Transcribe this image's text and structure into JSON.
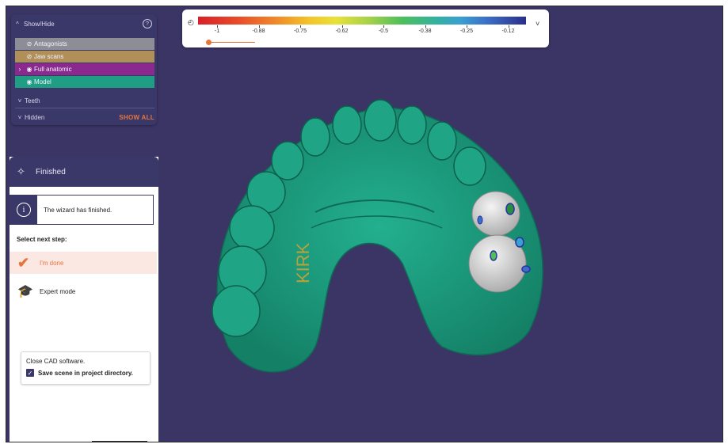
{
  "show_hide": {
    "title": "Show/Hide",
    "help_icon": "question-circle-icon",
    "layers": [
      {
        "label": "Antagonists",
        "color": "#8d8d96"
      },
      {
        "label": "Jaw scans",
        "color": "#b08f58"
      },
      {
        "label": "Full anatomic",
        "color": "#8a2a8e"
      },
      {
        "label": "Model",
        "color": "#1f9e83"
      }
    ],
    "teeth_label": "Teeth",
    "hidden_label": "Hidden",
    "show_all_label": "SHOW ALL"
  },
  "wizard": {
    "title": "Finished",
    "info_text": "The wizard has finished.",
    "next_step_label": "Select next step:",
    "options": [
      {
        "label": "I'm done",
        "icon": "checkmark-icon"
      },
      {
        "label": "Expert mode",
        "icon": "graduation-cap-icon"
      }
    ],
    "close_text": "Close CAD software.",
    "save_label": "Save scene in project directory.",
    "save_checked": true
  },
  "color_scale": {
    "tick_labels": [
      "-1",
      "-0.88",
      "-0.75",
      "-0.62",
      "-0.5",
      "-0.38",
      "-0.25",
      "-0.12"
    ]
  },
  "model": {
    "engraving": "KIRK",
    "colors": {
      "model": "#1f9e83",
      "crown": "#d9d9d9",
      "background": "#3b3565"
    }
  }
}
